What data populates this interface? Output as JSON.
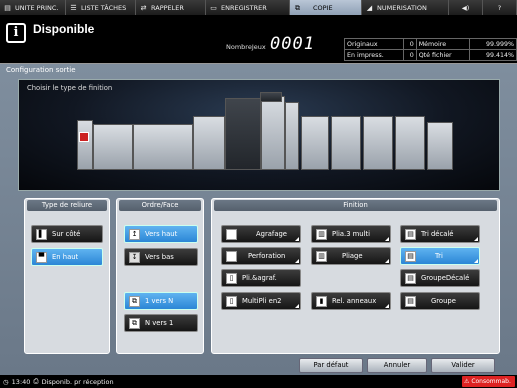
{
  "tabs": [
    {
      "label": "UNITE PRINC.",
      "icon": "printer-icon",
      "active": false
    },
    {
      "label": "LISTE TÂCHES",
      "icon": "list-icon",
      "active": false
    },
    {
      "label": "RAPPELER",
      "icon": "recall-icon",
      "active": false
    },
    {
      "label": "ENREGISTRER",
      "icon": "save-icon",
      "active": false
    },
    {
      "label": "COPIE",
      "icon": "copy-icon",
      "active": true
    },
    {
      "label": "NUMERISATION",
      "icon": "scan-icon",
      "active": false
    },
    {
      "label": "◀)",
      "icon": "speaker-icon",
      "active": false
    },
    {
      "label": "?",
      "icon": "help-icon",
      "active": false
    }
  ],
  "header": {
    "icon_glyph": "i",
    "title": "Disponible",
    "nbjeux_label": "NombreJeux",
    "nbjeux_value": "0001"
  },
  "counters": {
    "originaux_label": "Originaux",
    "originaux_value": "0",
    "memoire_label": "Mémoire",
    "memoire_value": "99.999%",
    "impress_label": "En impress.",
    "impress_value": "0",
    "qte_label": "Qté fichier",
    "qte_value": "99.414%"
  },
  "main": {
    "title": "Configuration sortie",
    "preview_label": "Choisir le type de finition"
  },
  "reliure": {
    "header": "Type de reliure",
    "buttons": [
      {
        "label": "Sur côté",
        "selected": false
      },
      {
        "label": "En haut",
        "selected": true
      }
    ]
  },
  "ordre": {
    "header": "Ordre/Face",
    "buttons": [
      {
        "label": "Vers haut",
        "selected": true
      },
      {
        "label": "Vers bas",
        "selected": false
      },
      {
        "label": "1 vers N",
        "selected": true
      },
      {
        "label": "N vers 1",
        "selected": false
      }
    ]
  },
  "finition": {
    "header": "Finition",
    "buttons": [
      {
        "label": "Agrafage",
        "selected": false
      },
      {
        "label": "Plia.3 multi",
        "selected": false
      },
      {
        "label": "Tri décalé",
        "selected": false
      },
      {
        "label": "Perforation",
        "selected": false
      },
      {
        "label": "Pliage",
        "selected": false
      },
      {
        "label": "Tri",
        "selected": true
      },
      {
        "label": "Pli.&agraf.",
        "selected": false
      },
      {
        "label": "GroupeDécalé",
        "selected": false
      },
      {
        "label": "MultiPli en2",
        "selected": false
      },
      {
        "label": "Rel. anneaux",
        "selected": false
      },
      {
        "label": "Groupe",
        "selected": false
      }
    ]
  },
  "footer": {
    "par_defaut": "Par défaut",
    "annuler": "Annuler",
    "valider": "Valider"
  },
  "status": {
    "time": "13:40",
    "text": "Disponib. pr réception",
    "conso": "Consommab."
  },
  "colors": {
    "accent": "#2b86d6",
    "panel": "#7f8e9e",
    "warning": "#dd2222"
  }
}
